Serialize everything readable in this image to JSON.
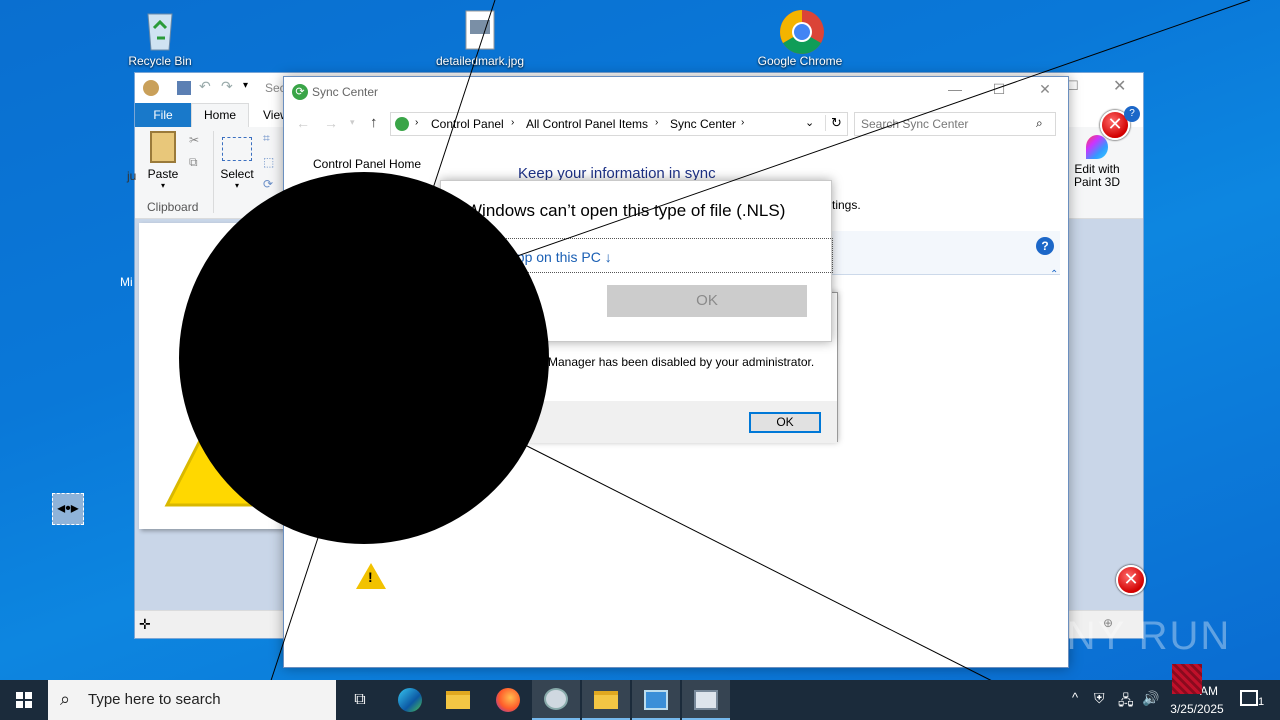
{
  "desktop": {
    "icons": [
      {
        "label": "Recycle Bin"
      },
      {
        "label": "detailedmark.jpg"
      },
      {
        "label": "Google Chrome"
      }
    ],
    "partial_label_ju": "ju",
    "partial_label_mi": "Mi"
  },
  "paint": {
    "quick_access_text": "Sec",
    "tabs": {
      "file": "File",
      "home": "Home",
      "view": "View"
    },
    "clipboard": {
      "paste": "Paste",
      "group": "Clipboard"
    },
    "image": {
      "select": "Select"
    },
    "edit_paint3d": "Edit with\nPaint 3D"
  },
  "sync_center": {
    "title": "Sync Center",
    "breadcrumb": [
      "Control Panel",
      "All Control Panel Items",
      "Sync Center"
    ],
    "search_placeholder": "Search Sync Center",
    "sidebar_home": "Control Panel Home",
    "heading": "Keep your information in sync",
    "partial_text": "tings."
  },
  "dialog_open": {
    "title": "Windows can’t open this type of file (.NLS)",
    "link_text": "app on this PC ↓",
    "ok": "OK"
  },
  "dialog_admin": {
    "message": "Manager has been disabled by your administrator.",
    "ok": "OK"
  },
  "taskbar": {
    "search_placeholder": "Type here to search",
    "time": "AM",
    "date": "3/25/2025",
    "notification_count": "1"
  },
  "watermark": "ANY RUN",
  "colors": {
    "accent": "#0078d7",
    "link": "#1a5fb4",
    "heading": "#1e3287",
    "taskbar": "#1b2b3b"
  }
}
